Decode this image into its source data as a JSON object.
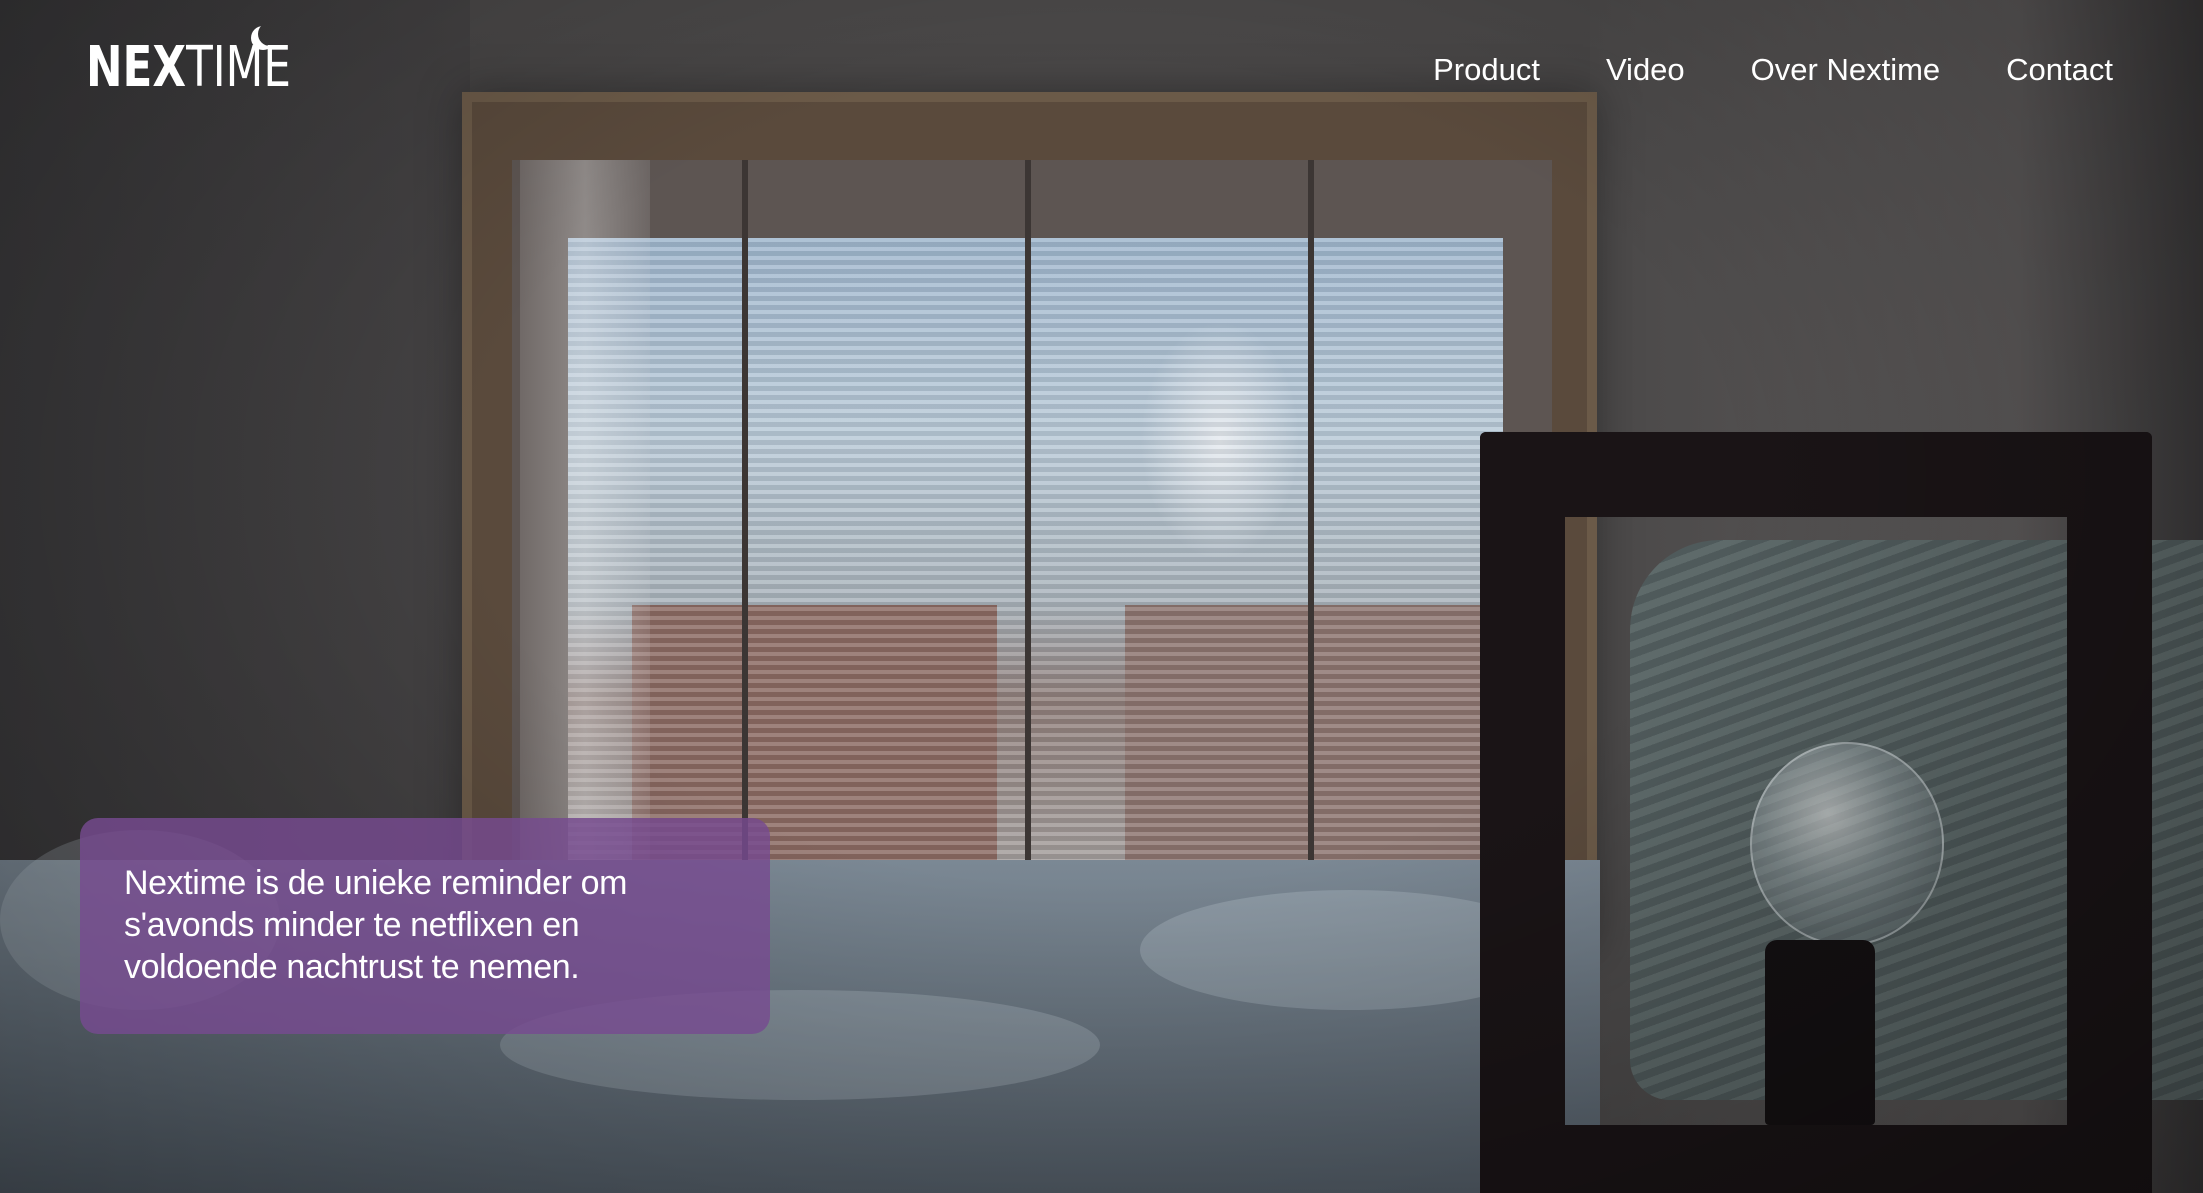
{
  "brand": {
    "logo_bold": "NEX",
    "logo_thin": "TIME",
    "logo_icon": "moon-icon"
  },
  "nav": {
    "items": [
      {
        "label": "Product"
      },
      {
        "label": "Video"
      },
      {
        "label": "Over Nextime"
      },
      {
        "label": "Contact"
      }
    ]
  },
  "hero": {
    "tagline": "Nextime is de unieke reminder om s'avonds minder te netflixen en voldoende nachtrust te nemen.",
    "tagline_box_color": "#764a90"
  }
}
